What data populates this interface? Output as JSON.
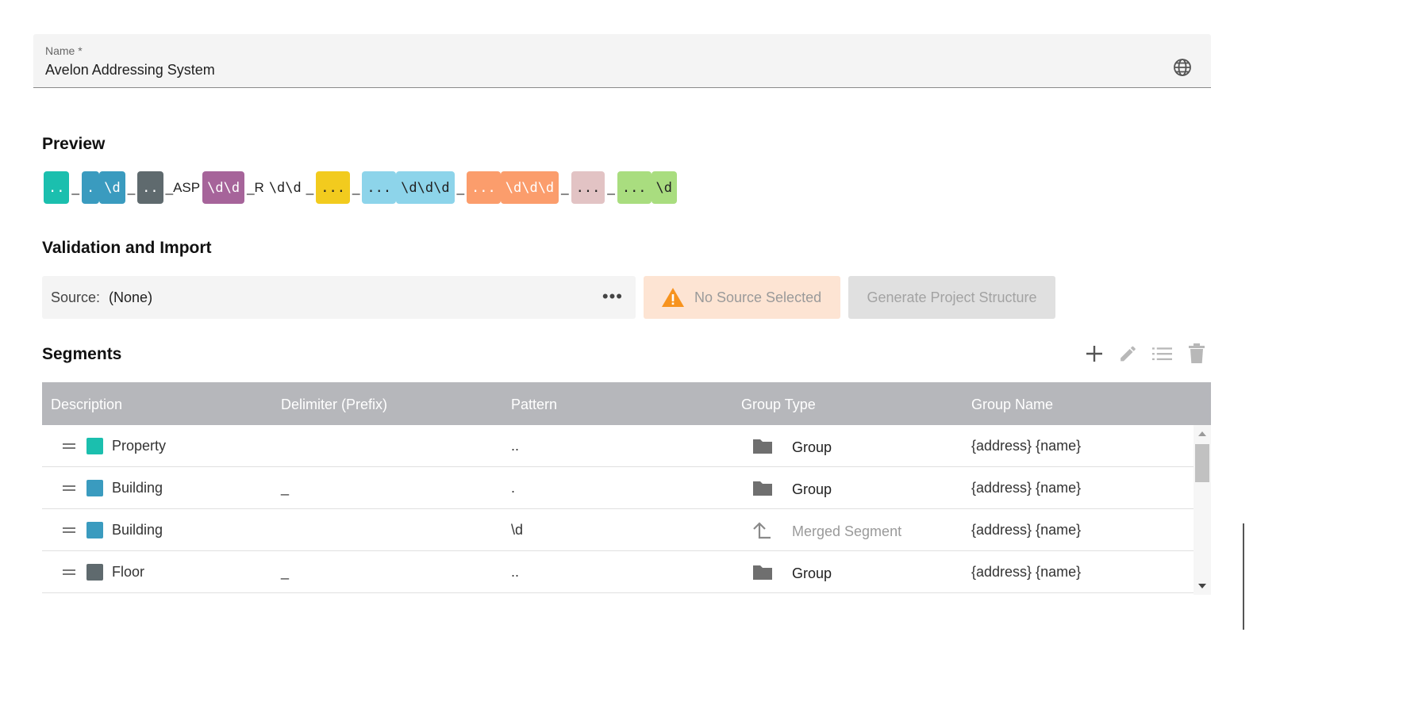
{
  "name_field": {
    "label": "Name *",
    "value": "Avelon Addressing System",
    "icon": "globe-icon"
  },
  "preview": {
    "heading": "Preview",
    "tokens": [
      {
        "kind": "chip",
        "text": "..",
        "color": "#1bbfae"
      },
      {
        "kind": "lit",
        "text": "_"
      },
      {
        "kind": "chip",
        "text": ".",
        "color": "#3a9bbf"
      },
      {
        "kind": "chip",
        "text": "\\d",
        "color": "#3a9bbf"
      },
      {
        "kind": "lit",
        "text": "_"
      },
      {
        "kind": "chip",
        "text": "..",
        "color": "#5f6a6e"
      },
      {
        "kind": "lit",
        "text": "_ASP"
      },
      {
        "kind": "chip",
        "text": "\\d\\d",
        "color": "#a6649a"
      },
      {
        "kind": "lit",
        "text": "_R"
      },
      {
        "kind": "litmono",
        "text": "\\d\\d"
      },
      {
        "kind": "lit",
        "text": "_"
      },
      {
        "kind": "chip",
        "text": "...",
        "color": "#f2cb1e",
        "dark": true
      },
      {
        "kind": "lit",
        "text": "_"
      },
      {
        "kind": "chip",
        "text": "...",
        "color": "#8dd4ea",
        "dark": true
      },
      {
        "kind": "chip",
        "text": "\\d\\d\\d",
        "color": "#8dd4ea",
        "dark": true
      },
      {
        "kind": "lit",
        "text": "_"
      },
      {
        "kind": "chip",
        "text": "...",
        "color": "#fb9d6c"
      },
      {
        "kind": "chip",
        "text": "\\d\\d\\d",
        "color": "#fb9d6c"
      },
      {
        "kind": "lit",
        "text": "_"
      },
      {
        "kind": "chip",
        "text": "...",
        "color": "#e2c3c4",
        "dark": true
      },
      {
        "kind": "lit",
        "text": "_"
      },
      {
        "kind": "chip",
        "text": "...",
        "color": "#a9dd7f",
        "dark": true
      },
      {
        "kind": "chip",
        "text": "\\d",
        "color": "#a9dd7f",
        "dark": true
      }
    ]
  },
  "validation": {
    "heading": "Validation and Import",
    "source_label": "Source:",
    "source_value": "(None)",
    "more_icon": "more-horizontal-icon",
    "warning_text": "No Source Selected",
    "warning_icon": "warning-icon",
    "generate_label": "Generate Project Structure"
  },
  "segments": {
    "heading": "Segments",
    "toolbar_icons": [
      "add-icon",
      "edit-icon",
      "list-icon",
      "delete-icon"
    ],
    "columns": [
      "Description",
      "Delimiter (Prefix)",
      "Pattern",
      "Group Type",
      "Group Name"
    ],
    "rows": [
      {
        "description": "Property",
        "color": "#1bbfae",
        "delimiter": "",
        "pattern": "..",
        "group_type": "Group",
        "group_icon": "folder-icon",
        "group_name": "{address} {name}"
      },
      {
        "description": "Building",
        "color": "#3a9bbf",
        "delimiter": "_",
        "pattern": ".",
        "group_type": "Group",
        "group_icon": "folder-icon",
        "group_name": "{address} {name}"
      },
      {
        "description": "Building",
        "color": "#3a9bbf",
        "delimiter": "",
        "pattern": "\\d",
        "group_type": "Merged Segment",
        "group_icon": "merge-up-icon",
        "group_name": "{address} {name}"
      },
      {
        "description": "Floor",
        "color": "#5f6a6e",
        "delimiter": "_",
        "pattern": "..",
        "group_type": "Group",
        "group_icon": "folder-icon",
        "group_name": "{address} {name}"
      }
    ]
  }
}
